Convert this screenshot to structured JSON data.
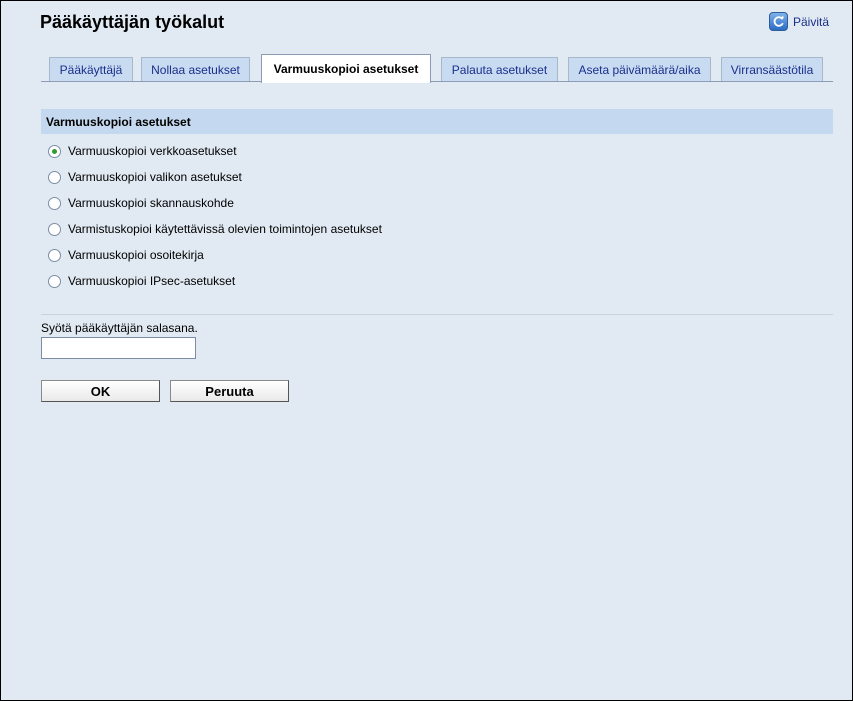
{
  "header": {
    "title": "Pääkäyttäjän työkalut",
    "refresh_label": "Päivitä"
  },
  "tabs": [
    {
      "label": "Pääkäyttäjä",
      "active": false
    },
    {
      "label": "Nollaa asetukset",
      "active": false
    },
    {
      "label": "Varmuuskopioi asetukset",
      "active": true
    },
    {
      "label": "Palauta asetukset",
      "active": false
    },
    {
      "label": "Aseta päivämäärä/aika",
      "active": false
    },
    {
      "label": "Virransäästötila",
      "active": false
    }
  ],
  "section": {
    "title": "Varmuuskopioi asetukset",
    "options": [
      {
        "label": "Varmuuskopioi verkkoasetukset",
        "selected": true
      },
      {
        "label": "Varmuuskopioi valikon asetukset",
        "selected": false
      },
      {
        "label": "Varmuuskopioi skannauskohde",
        "selected": false
      },
      {
        "label": "Varmistuskopioi käytettävissä olevien toimintojen asetukset",
        "selected": false
      },
      {
        "label": "Varmuuskopioi osoitekirja",
        "selected": false
      },
      {
        "label": "Varmuuskopioi IPsec-asetukset",
        "selected": false
      }
    ]
  },
  "password": {
    "label": "Syötä pääkäyttäjän salasana.",
    "value": "",
    "placeholder": ""
  },
  "buttons": {
    "ok_label": "OK",
    "cancel_label": "Peruuta"
  },
  "colors": {
    "background": "#e1e9f2",
    "tab_inactive": "#c8dbf1",
    "section_header": "#c4d9ef",
    "link": "#1a2f8c",
    "radio_selected": "#2f9a2f"
  }
}
